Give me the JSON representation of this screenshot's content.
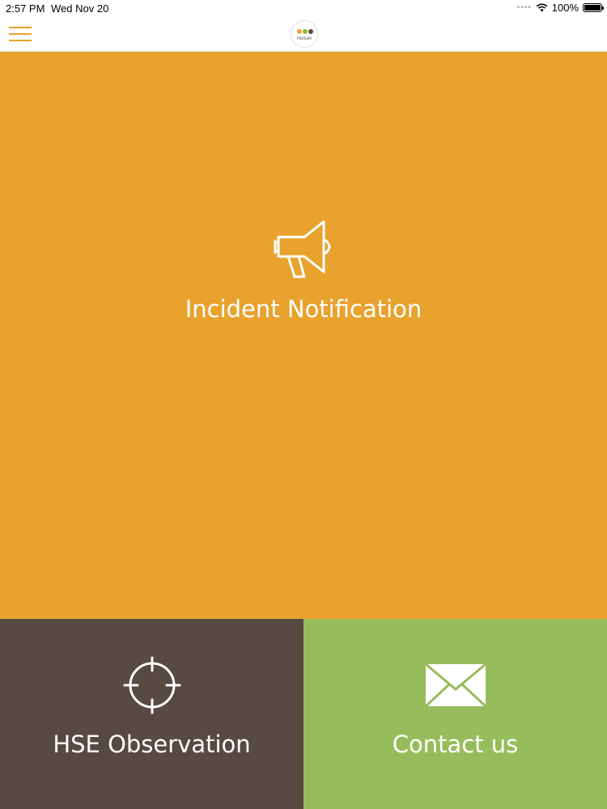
{
  "status_bar": {
    "time": "2:57 PM",
    "date": "Wed Nov 20",
    "battery": "100%"
  },
  "header": {
    "menu_icon": "hamburger-menu-icon",
    "logo_text": "FileSafe",
    "logo_dot_colors": [
      "#f0a030",
      "#8bbd3c",
      "#5a4a40"
    ]
  },
  "tiles": {
    "incident": {
      "label": "Incident Notification",
      "icon": "megaphone-icon",
      "color": "#e8a22d"
    },
    "hse": {
      "label": "HSE Observation",
      "icon": "crosshair-icon",
      "color": "#564a42"
    },
    "contact": {
      "label": "Contact us",
      "icon": "envelope-icon",
      "color": "#97bc5c"
    }
  }
}
